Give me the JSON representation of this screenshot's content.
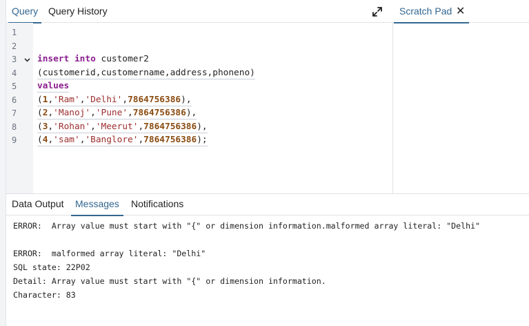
{
  "query_tabs": {
    "query": "Query",
    "history": "Query History"
  },
  "line_numbers": [
    "1",
    "2",
    "3",
    "4",
    "5",
    "6",
    "7",
    "8",
    "9"
  ],
  "code": {
    "l3_kw1": "insert",
    "l3_kw2": "into",
    "l3_rest": " customer2",
    "l4": "(customerid,customername,address,phoneno)",
    "l5_kw": "values",
    "rows": [
      {
        "open": "(",
        "n": "1",
        "c1": ",",
        "s1": "'Ram'",
        "c2": ",",
        "s2": "'Delhi'",
        "c3": ",",
        "p": "7864756386",
        "end": "),"
      },
      {
        "open": "(",
        "n": "2",
        "c1": ",",
        "s1": "'Manoj'",
        "c2": ",",
        "s2": "'Pune'",
        "c3": ",",
        "p": "7864756386",
        "end": "),"
      },
      {
        "open": "(",
        "n": "3",
        "c1": ",",
        "s1": "'Rohan'",
        "c2": ",",
        "s2": "'Meerut'",
        "c3": ",",
        "p": "7864756386",
        "end": "),"
      },
      {
        "open": "(",
        "n": "4",
        "c1": ",",
        "s1": "'sam'",
        "c2": ",",
        "s2": "'Banglore'",
        "c3": ",",
        "p": "7864756386",
        "end": ");"
      }
    ]
  },
  "scratch": {
    "title": "Scratch Pad",
    "close": "✕"
  },
  "bottom_tabs": {
    "data_output": "Data Output",
    "messages": "Messages",
    "notifications": "Notifications"
  },
  "messages": [
    "ERROR:  Array value must start with \"{\" or dimension information.malformed array literal: \"Delhi\"",
    "ERROR:  malformed array literal: \"Delhi\"",
    "SQL state: 22P02",
    "Detail: Array value must start with \"{\" or dimension information.",
    "Character: 83"
  ],
  "colors": {
    "accent": "#326690",
    "keyword": "#8b1f8f",
    "string": "#9c2d2d",
    "number": "#8a4b10"
  },
  "icons": {
    "expand": "expand-icon",
    "fold": "chevron-down-icon",
    "close": "close-icon"
  }
}
